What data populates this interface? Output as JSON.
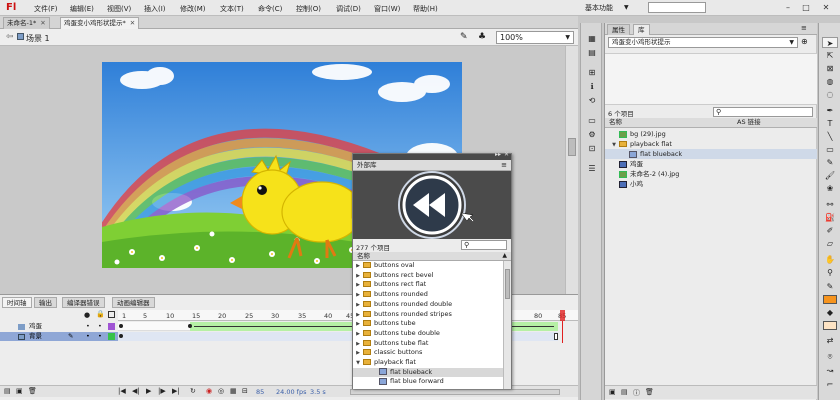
{
  "app": {
    "logo": "Fl"
  },
  "menu": [
    "文件(F)",
    "编辑(E)",
    "视图(V)",
    "插入(I)",
    "修改(M)",
    "文本(T)",
    "命令(C)",
    "控制(O)",
    "调试(D)",
    "窗口(W)",
    "帮助(H)"
  ],
  "workspace": {
    "label": "基本功能"
  },
  "doc_tabs": [
    {
      "label": "未命名-1*"
    },
    {
      "label": "鸡蛋变小鸡形状提示*"
    }
  ],
  "scene": {
    "label": "场景 1",
    "zoom": "100%"
  },
  "timeline": {
    "tabs": [
      "时间轴",
      "输出",
      "编译器错误",
      "动画编辑器"
    ],
    "layers": [
      {
        "name": "鸡蛋",
        "selected": false
      },
      {
        "name": "背景",
        "selected": true
      }
    ],
    "frame_numbers": [
      "1",
      "5",
      "10",
      "15",
      "20",
      "25",
      "30",
      "35",
      "40",
      "45",
      "80",
      "85"
    ],
    "status": {
      "frame": "85",
      "fps": "24.00 fps",
      "time": "3.5 s"
    }
  },
  "library": {
    "tabs": [
      "属性",
      "库"
    ],
    "document": "鸡蛋变小鸡形状提示",
    "count": "6 个项目",
    "header_name": "名称",
    "header_linkage": "AS 链接",
    "items": [
      {
        "label": "bg (29).jpg",
        "kind": "bitmap",
        "indent": 0
      },
      {
        "label": "playback flat",
        "kind": "folder",
        "indent": 0
      },
      {
        "label": "flat blueback",
        "kind": "button",
        "indent": 1,
        "selected": true
      },
      {
        "label": "鸡蛋",
        "kind": "movieclip",
        "indent": 0
      },
      {
        "label": "未命名-2 (4).jpg",
        "kind": "bitmap",
        "indent": 0
      },
      {
        "label": "小鸡",
        "kind": "movieclip",
        "indent": 0
      }
    ]
  },
  "external_library": {
    "title": "外部库",
    "count": "277 个项目",
    "header_name": "名称",
    "items": [
      {
        "label": "buttons oval",
        "kind": "folder"
      },
      {
        "label": "buttons rect bevel",
        "kind": "folder"
      },
      {
        "label": "buttons rect flat",
        "kind": "folder"
      },
      {
        "label": "buttons rounded",
        "kind": "folder"
      },
      {
        "label": "buttons rounded double",
        "kind": "folder"
      },
      {
        "label": "buttons rounded stripes",
        "kind": "folder"
      },
      {
        "label": "buttons tube",
        "kind": "folder"
      },
      {
        "label": "buttons tube double",
        "kind": "folder"
      },
      {
        "label": "buttons tube flat",
        "kind": "folder"
      },
      {
        "label": "classic buttons",
        "kind": "folder"
      },
      {
        "label": "playback flat",
        "kind": "folder-open"
      },
      {
        "label": "flat blueback",
        "kind": "button",
        "selected": true
      },
      {
        "label": "flat blue forward",
        "kind": "button"
      }
    ]
  },
  "colors": {
    "sky": "#3b86d9",
    "grass": "#6bbf2a",
    "chick": "#f6e21a",
    "accent_red": "#e02020"
  }
}
